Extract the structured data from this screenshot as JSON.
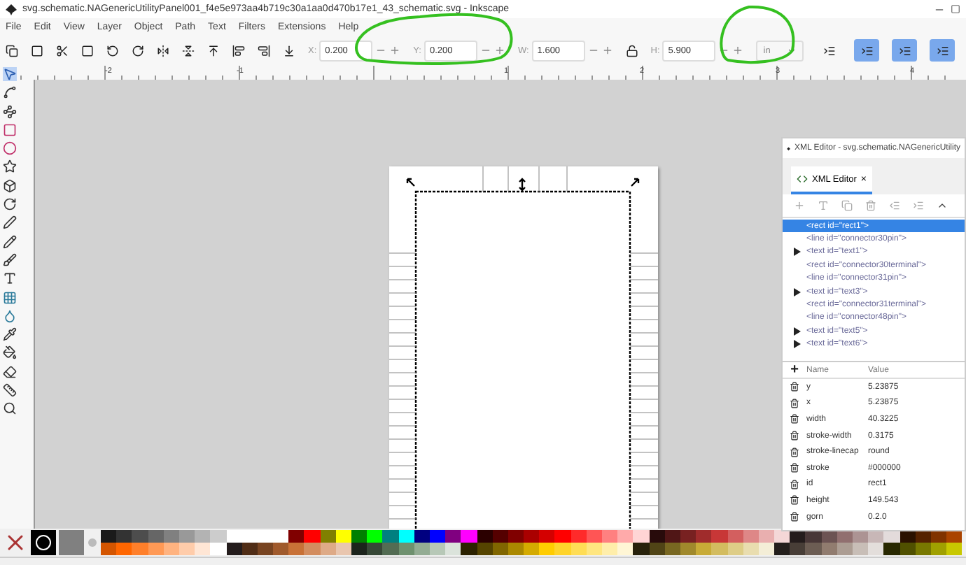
{
  "window": {
    "title": "svg.schematic.NAGenericUtilityPanel001_f4e5e973aa4b719c30a1aa0d470b17e1_43_schematic.svg - Inkscape"
  },
  "menu": [
    "File",
    "Edit",
    "View",
    "Layer",
    "Object",
    "Path",
    "Text",
    "Filters",
    "Extensions",
    "Help"
  ],
  "tool_controls": {
    "fields": [
      {
        "label": "X:",
        "value": "0.200"
      },
      {
        "label": "Y:",
        "value": "0.200"
      },
      {
        "label": "W:",
        "value": "1.600"
      },
      {
        "label": "H:",
        "value": "5.900"
      }
    ],
    "unit": "in",
    "toggles": [
      {
        "on": false
      },
      {
        "on": true
      },
      {
        "on": true
      },
      {
        "on": true
      }
    ]
  },
  "ruler": {
    "labels": [
      "-2",
      "-1",
      "1",
      "2",
      "3",
      "4"
    ]
  },
  "xml_editor": {
    "title": "XML Editor - svg.schematic.NAGenericUtility",
    "tab": "XML Editor",
    "tab_close": "×",
    "nodes": [
      {
        "text": "<rect id=\"rect1\">",
        "has_children": false,
        "selected": true
      },
      {
        "text": "<line id=\"connector30pin\">",
        "has_children": false,
        "selected": false
      },
      {
        "text": "<text id=\"text1\">",
        "has_children": true,
        "selected": false
      },
      {
        "text": "<rect id=\"connector30terminal\">",
        "has_children": false,
        "selected": false
      },
      {
        "text": "<line id=\"connector31pin\">",
        "has_children": false,
        "selected": false
      },
      {
        "text": "<text id=\"text3\">",
        "has_children": true,
        "selected": false
      },
      {
        "text": "<rect id=\"connector31terminal\">",
        "has_children": false,
        "selected": false
      },
      {
        "text": "<line id=\"connector48pin\">",
        "has_children": false,
        "selected": false
      },
      {
        "text": "<text id=\"text5\">",
        "has_children": true,
        "selected": false
      },
      {
        "text": "<text id=\"text6\">",
        "has_children": true,
        "selected": false
      }
    ],
    "attributes": {
      "add": "+",
      "columns": [
        "Name",
        "Value"
      ],
      "rows": [
        {
          "name": "y",
          "value": "5.23875"
        },
        {
          "name": "x",
          "value": "5.23875"
        },
        {
          "name": "width",
          "value": "40.3225"
        },
        {
          "name": "stroke-width",
          "value": "0.3175"
        },
        {
          "name": "stroke-linecap",
          "value": "round"
        },
        {
          "name": "stroke",
          "value": "#000000"
        },
        {
          "name": "id",
          "value": "rect1"
        },
        {
          "name": "height",
          "value": "149.543"
        },
        {
          "name": "gorn",
          "value": "0.2.0"
        }
      ]
    }
  },
  "palette": {
    "rows": [
      [
        {
          "color": "#1a1a1a"
        },
        {
          "color": "#333333"
        },
        {
          "color": "#4d4d4d"
        },
        {
          "color": "#666666"
        },
        {
          "color": "#808080"
        },
        {
          "color": "#999999"
        },
        {
          "color": "#b3b3b3"
        },
        {
          "color": "#cccccc"
        },
        {
          "color": "#ffffff"
        },
        {
          "color": "#ffffff"
        },
        {
          "color": "#ffffff"
        },
        {
          "color": "#ffffff"
        },
        {
          "color": "#800000"
        },
        {
          "color": "#ff0000"
        },
        {
          "color": "#808000"
        },
        {
          "color": "#ffff00"
        },
        {
          "color": "#008000"
        },
        {
          "color": "#00ff00"
        },
        {
          "color": "#008080"
        },
        {
          "color": "#00ffff"
        },
        {
          "color": "#000080"
        },
        {
          "color": "#0000ff"
        },
        {
          "color": "#800080"
        },
        {
          "color": "#ff00ff"
        },
        {
          "color": "#2b0000"
        },
        {
          "color": "#550000"
        },
        {
          "color": "#800000"
        },
        {
          "color": "#aa0000"
        },
        {
          "color": "#d40000"
        },
        {
          "color": "#ff0000"
        },
        {
          "color": "#ff2a2a"
        },
        {
          "color": "#ff5555"
        },
        {
          "color": "#ff8080"
        },
        {
          "color": "#ffaaaa"
        },
        {
          "color": "#ffd5d5"
        },
        {
          "color": "#280b0b"
        },
        {
          "color": "#501616"
        },
        {
          "color": "#782121"
        },
        {
          "color": "#a02c2c"
        },
        {
          "color": "#c83737"
        },
        {
          "color": "#d35f5f"
        },
        {
          "color": "#de8787"
        },
        {
          "color": "#e9afaf"
        },
        {
          "color": "#f4d7d7"
        },
        {
          "color": "#241c1c"
        },
        {
          "color": "#483737"
        },
        {
          "color": "#6c5353"
        },
        {
          "color": "#916f6f"
        },
        {
          "color": "#ac9393"
        },
        {
          "color": "#c8b7b7"
        },
        {
          "color": "#e3dbdb"
        },
        {
          "color": "#2b1100"
        },
        {
          "color": "#552200"
        },
        {
          "color": "#803300"
        },
        {
          "color": "#aa4400"
        }
      ],
      [
        {
          "color": "#d45500"
        },
        {
          "color": "#ff6600"
        },
        {
          "color": "#ff7f2a"
        },
        {
          "color": "#ff9955"
        },
        {
          "color": "#ffb380"
        },
        {
          "color": "#ffccaa"
        },
        {
          "color": "#ffe6d5"
        },
        {
          "color": "#ffffff"
        },
        {
          "color": "#241c1c"
        },
        {
          "color": "#502d16"
        },
        {
          "color": "#784421"
        },
        {
          "color": "#a05a2c"
        },
        {
          "color": "#c87137"
        },
        {
          "color": "#d38d5f"
        },
        {
          "color": "#deaa87"
        },
        {
          "color": "#e9c6af"
        },
        {
          "color": "#1c241c"
        },
        {
          "color": "#374837"
        },
        {
          "color": "#536c53"
        },
        {
          "color": "#6f916f"
        },
        {
          "color": "#93ac93"
        },
        {
          "color": "#b7c8b7"
        },
        {
          "color": "#dbe3db"
        },
        {
          "color": "#2b2200"
        },
        {
          "color": "#554400"
        },
        {
          "color": "#806600"
        },
        {
          "color": "#aa8800"
        },
        {
          "color": "#d4aa00"
        },
        {
          "color": "#ffcc00"
        },
        {
          "color": "#ffd42a"
        },
        {
          "color": "#ffdd55"
        },
        {
          "color": "#ffe680"
        },
        {
          "color": "#ffeeaa"
        },
        {
          "color": "#fff6d5"
        },
        {
          "color": "#28220b"
        },
        {
          "color": "#504416"
        },
        {
          "color": "#786721"
        },
        {
          "color": "#a0892c"
        },
        {
          "color": "#c8ab37"
        },
        {
          "color": "#d3bc5f"
        },
        {
          "color": "#decd87"
        },
        {
          "color": "#e9ddaf"
        },
        {
          "color": "#f4eed7"
        },
        {
          "color": "#241f1c"
        },
        {
          "color": "#483e37"
        },
        {
          "color": "#6c5d53"
        },
        {
          "color": "#917c6f"
        },
        {
          "color": "#ac9d93"
        },
        {
          "color": "#c8beb7"
        },
        {
          "color": "#e3dedb"
        },
        {
          "color": "#282800"
        },
        {
          "color": "#505000"
        },
        {
          "color": "#787800"
        },
        {
          "color": "#a0a000"
        },
        {
          "color": "#c8c800"
        }
      ]
    ]
  }
}
